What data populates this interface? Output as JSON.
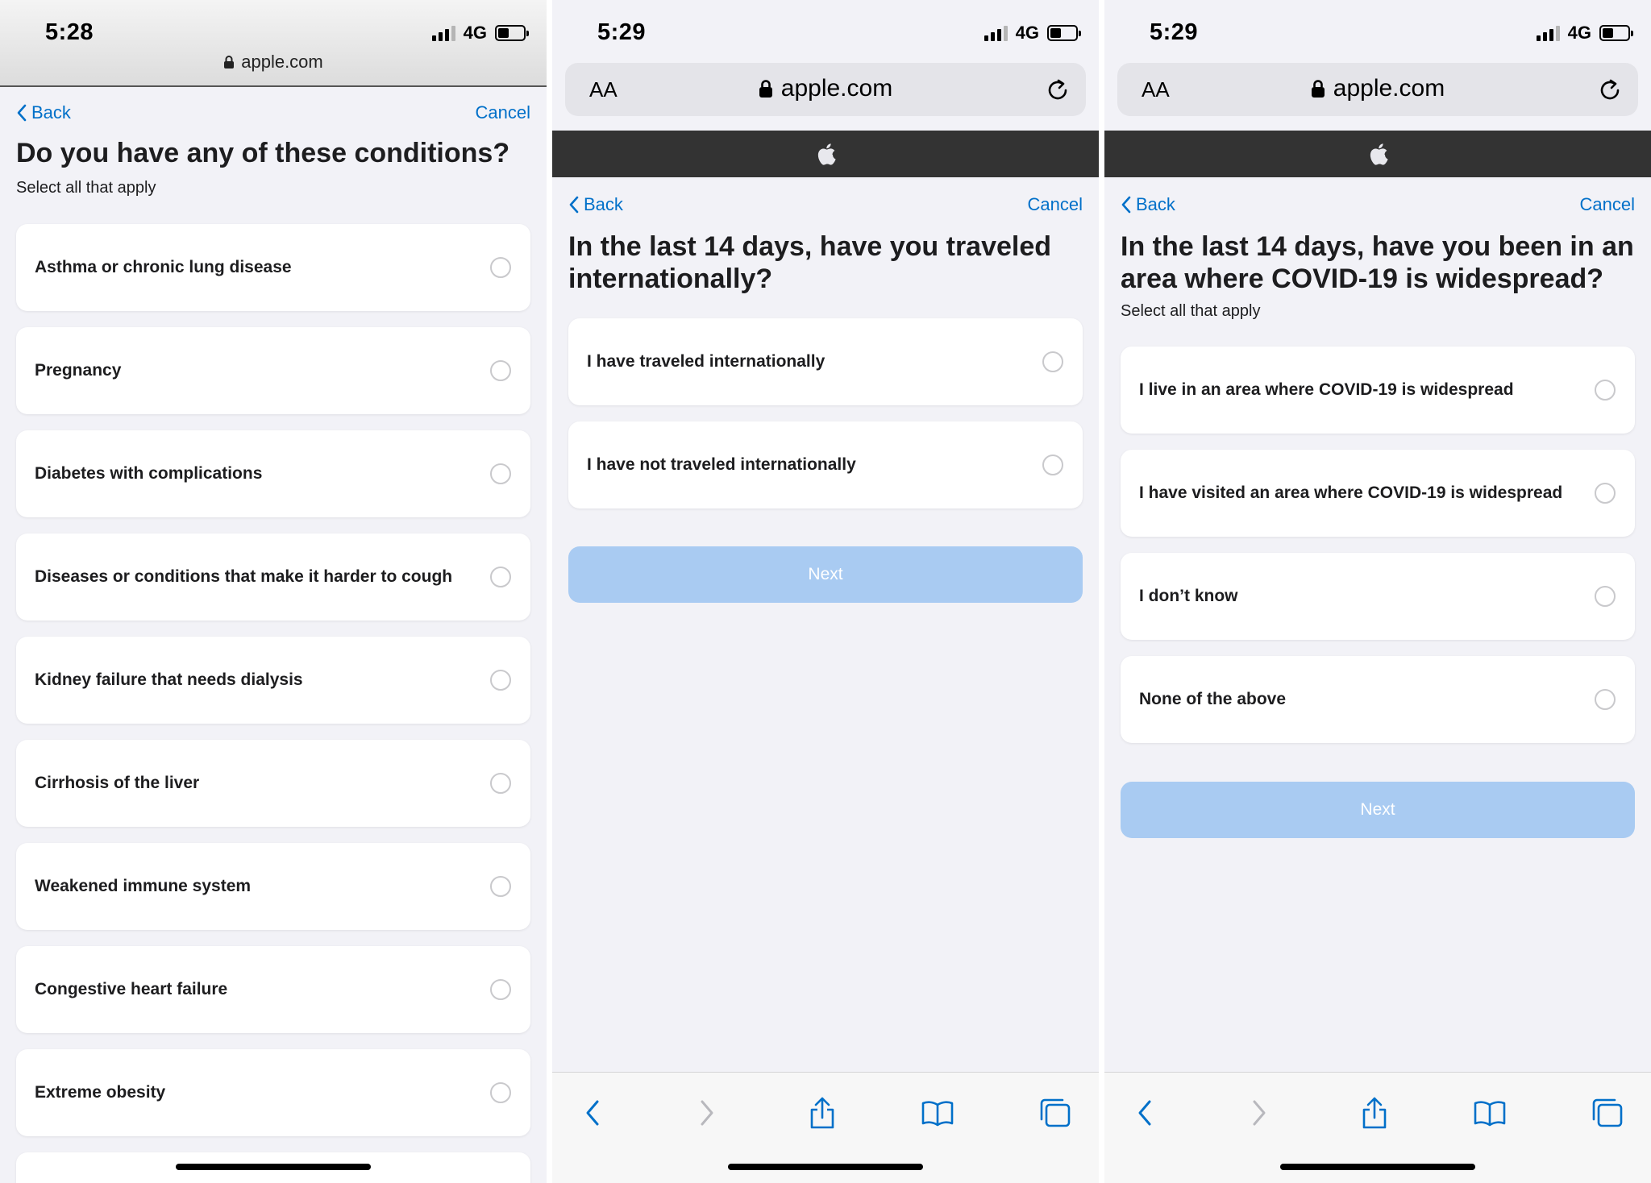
{
  "panels": [
    {
      "status": {
        "time": "5:28",
        "network": "4G"
      },
      "url": "apple.com",
      "nav": {
        "back_label": "Back",
        "cancel_label": "Cancel"
      },
      "title": "Do you have any of these conditions?",
      "subtitle": "Select all that apply",
      "options": [
        "Asthma or chronic lung disease",
        "Pregnancy",
        "Diabetes with complications",
        "Diseases or conditions that make it harder to cough",
        "Kidney failure that needs dialysis",
        "Cirrhosis of the liver",
        "Weakened immune system",
        "Congestive heart failure",
        "Extreme obesity"
      ]
    },
    {
      "status": {
        "time": "5:29",
        "network": "4G"
      },
      "url": "apple.com",
      "text_size_label": "AA",
      "nav": {
        "back_label": "Back",
        "cancel_label": "Cancel"
      },
      "title": "In the last 14 days, have you traveled internationally?",
      "options": [
        "I have traveled internationally",
        "I have not traveled internationally"
      ],
      "next_label": "Next"
    },
    {
      "status": {
        "time": "5:29",
        "network": "4G"
      },
      "url": "apple.com",
      "text_size_label": "AA",
      "nav": {
        "back_label": "Back",
        "cancel_label": "Cancel"
      },
      "title": "In the last 14 days, have you been in an area where COVID-19 is widespread?",
      "subtitle": "Select all that apply",
      "options": [
        "I live in an area where COVID-19 is widespread",
        "I have visited an area where COVID-19 is widespread",
        "I don’t know",
        "None of the above"
      ],
      "next_label": "Next"
    }
  ],
  "colors": {
    "link_blue": "#0070c9",
    "next_disabled": "#a9cbf2",
    "apple_bar": "#333333",
    "page_bg": "#f2f2f7"
  },
  "icons": {
    "lock": "lock-icon",
    "reload": "reload-icon",
    "apple_logo": "apple-logo-icon",
    "back_chevron": "chevron-left-icon",
    "toolbar": [
      "back-arrow-icon",
      "forward-arrow-icon",
      "share-icon",
      "bookmarks-icon",
      "tabs-icon"
    ]
  }
}
